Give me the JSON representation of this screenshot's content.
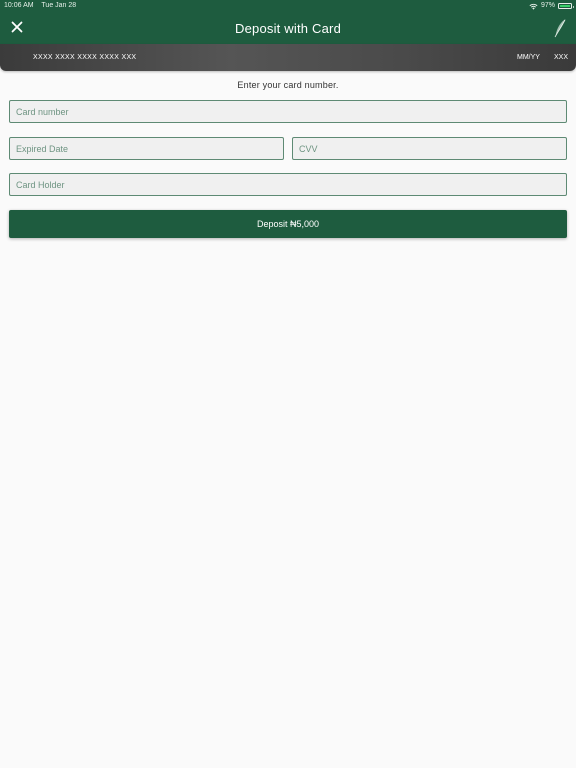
{
  "status_bar": {
    "time": "10:06 AM",
    "date": "Tue Jan 28",
    "battery_percent": "97%",
    "battery_level": 0.97,
    "wifi_icon": "wifi-icon",
    "battery_icon": "battery-icon"
  },
  "nav": {
    "title": "Deposit with Card",
    "close_icon": "close-icon",
    "brand_icon": "feather-icon"
  },
  "card_preview": {
    "number": "XXXX XXXX XXXX XXXX XXX",
    "expiry": "MM/YY",
    "cvv": "XXX"
  },
  "form": {
    "instruction": "Enter your card number.",
    "card_number": {
      "value": "",
      "placeholder": "Card number"
    },
    "expiry_date": {
      "value": "",
      "placeholder": "Expired Date"
    },
    "cvv": {
      "value": "",
      "placeholder": "CVV"
    },
    "card_holder": {
      "value": "",
      "placeholder": "Card Holder"
    },
    "deposit_label": "Deposit ₦5,000"
  },
  "colors": {
    "brand_green": "#1e5c3f",
    "field_border": "#5e8a74",
    "field_background": "#f0f0f0",
    "background": "#fafafa"
  }
}
